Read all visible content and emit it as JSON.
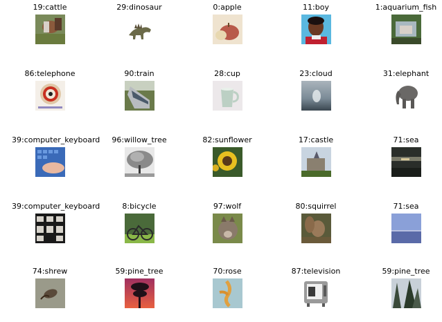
{
  "grid": [
    [
      {
        "id": 19,
        "label": "19:cattle"
      },
      {
        "id": 29,
        "label": "29:dinosaur"
      },
      {
        "id": 0,
        "label": "0:apple"
      },
      {
        "id": 11,
        "label": "11:boy"
      },
      {
        "id": 1,
        "label": "1:aquarium_fish"
      }
    ],
    [
      {
        "id": 86,
        "label": "86:telephone"
      },
      {
        "id": 90,
        "label": "90:train"
      },
      {
        "id": 28,
        "label": "28:cup"
      },
      {
        "id": 23,
        "label": "23:cloud"
      },
      {
        "id": 31,
        "label": "31:elephant"
      }
    ],
    [
      {
        "id": 39,
        "label": "39:computer_keyboard"
      },
      {
        "id": 96,
        "label": "96:willow_tree"
      },
      {
        "id": 82,
        "label": "82:sunflower"
      },
      {
        "id": 17,
        "label": "17:castle"
      },
      {
        "id": 71,
        "label": "71:sea"
      }
    ],
    [
      {
        "id": 39,
        "label": "39:computer_keyboard"
      },
      {
        "id": 8,
        "label": "8:bicycle"
      },
      {
        "id": 97,
        "label": "97:wolf"
      },
      {
        "id": 80,
        "label": "80:squirrel"
      },
      {
        "id": 71,
        "label": "71:sea"
      }
    ],
    [
      {
        "id": 74,
        "label": "74:shrew"
      },
      {
        "id": 59,
        "label": "59:pine_tree"
      },
      {
        "id": 70,
        "label": "70:rose"
      },
      {
        "id": 87,
        "label": "87:television"
      },
      {
        "id": 59,
        "label": "59:pine_tree"
      }
    ]
  ]
}
